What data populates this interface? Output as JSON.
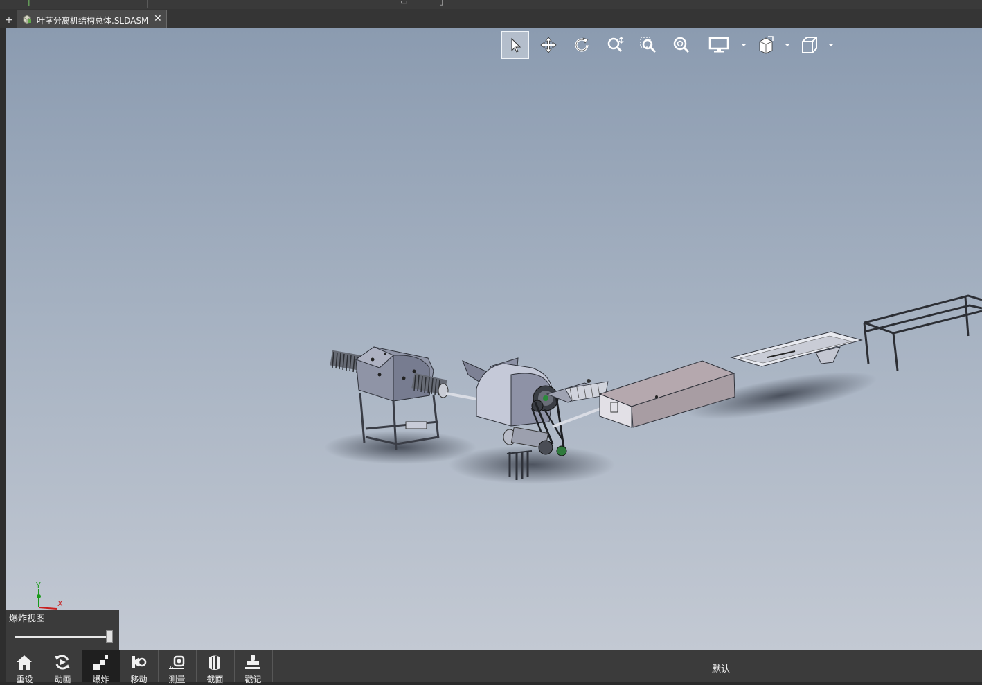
{
  "tabs": {
    "new_tab_symbol": "+",
    "document_title": "叶茎分离机结构总体.SLDASM",
    "close_symbol": "✕"
  },
  "viewport_toolbar": {
    "tools": [
      "select-icon",
      "pan-icon",
      "rotate-icon",
      "zoom-icon",
      "zoom-window-icon",
      "zoom-fit-icon",
      "display-style-icon",
      "view-orientation-icon",
      "standard-views-icon"
    ],
    "active_tool": "select-icon"
  },
  "triad": {
    "y_label": "Y",
    "x_label": "X"
  },
  "explode_panel": {
    "title": "爆炸视图",
    "slider_value": 1.0
  },
  "bottom_toolbar": {
    "items": [
      {
        "label": "重设",
        "icon": "home-icon"
      },
      {
        "label": "动画",
        "icon": "animation-icon"
      },
      {
        "label": "爆炸",
        "icon": "explode-icon"
      },
      {
        "label": "移动",
        "icon": "move-icon"
      },
      {
        "label": "测量",
        "icon": "measure-icon"
      },
      {
        "label": "截面",
        "icon": "section-icon"
      },
      {
        "label": "戳记",
        "icon": "stamp-icon"
      }
    ],
    "active_item": "爆炸",
    "configuration": "默认"
  },
  "colors": {
    "viewport_top": "#8b9bb0",
    "viewport_bottom": "#c3c9d3",
    "panel_bg": "#3b3b3b",
    "triad_y": "#1a9a1a",
    "triad_x": "#c82020"
  }
}
